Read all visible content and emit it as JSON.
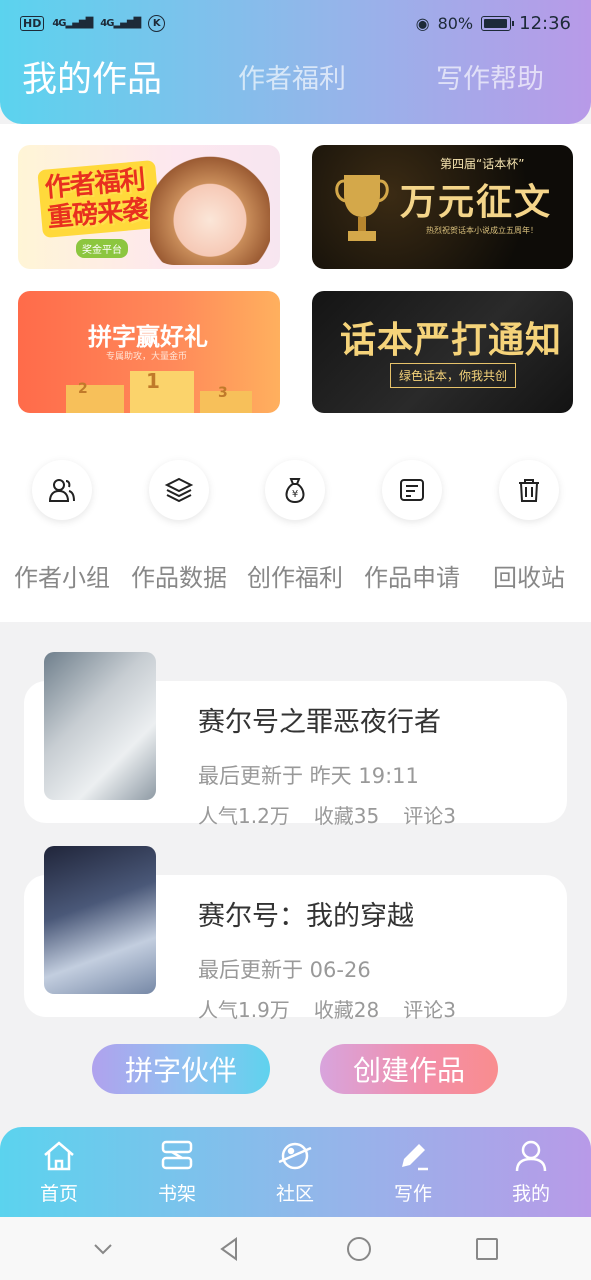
{
  "status_bar": {
    "left_hd": "HD",
    "signal_1": "4G",
    "signal_2": "4G",
    "k_icon": "K",
    "battery_percent": "80%",
    "time": "12:36"
  },
  "top_tabs": [
    {
      "label": "我的作品",
      "active": true
    },
    {
      "label": "作者福利",
      "active": false
    },
    {
      "label": "写作帮助",
      "active": false
    }
  ],
  "banners": [
    {
      "title": "作者福利重磅来袭",
      "badge": "奖金平台"
    },
    {
      "subtitle": "第四届“话本杯”",
      "title": "万元征文",
      "small": "热烈祝贺话本小说成立五周年！"
    },
    {
      "title": "拼字赢好礼",
      "subtitle": "专属助攻，大量金币",
      "podium": [
        "2",
        "1",
        "3"
      ]
    },
    {
      "title": "话本严打通知",
      "subtitle": "绿色话本，你我共创"
    }
  ],
  "functions": [
    {
      "label": "作者小组",
      "icon": "group-icon"
    },
    {
      "label": "作品数据",
      "icon": "layers-icon"
    },
    {
      "label": "创作福利",
      "icon": "money-bag-icon"
    },
    {
      "label": "作品申请",
      "icon": "document-icon"
    },
    {
      "label": "回收站",
      "icon": "trash-icon"
    }
  ],
  "works": [
    {
      "title": "赛尔号之罪恶夜行者",
      "last_update": "最后更新于 昨天 19:11",
      "popularity": "人气1.2万",
      "favorites": "收藏35",
      "comments": "评论3"
    },
    {
      "title": "赛尔号：我的穿越",
      "last_update": "最后更新于 06-26",
      "popularity": "人气1.9万",
      "favorites": "收藏28",
      "comments": "评论3"
    }
  ],
  "actions": {
    "partner_label": "拼字伙伴",
    "create_label": "创建作品"
  },
  "bottom_nav": [
    {
      "label": "首页",
      "icon": "home-icon"
    },
    {
      "label": "书架",
      "icon": "bookshelf-icon"
    },
    {
      "label": "社区",
      "icon": "planet-icon"
    },
    {
      "label": "写作",
      "icon": "pen-icon"
    },
    {
      "label": "我的",
      "icon": "user-icon"
    }
  ],
  "colors": {
    "header_gradient_start": "#5bd3ee",
    "header_gradient_end": "#b89ae8"
  }
}
